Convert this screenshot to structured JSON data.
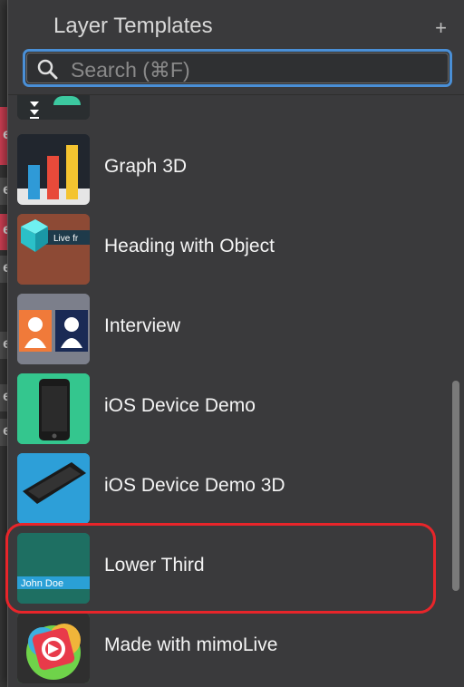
{
  "panel": {
    "title": "Layer Templates",
    "add_button": "+",
    "search_placeholder": "Search (⌘F)"
  },
  "items": [
    {
      "label": ""
    },
    {
      "label": "Graph 3D"
    },
    {
      "label": "Heading with Object",
      "thumb_text": "Live fr"
    },
    {
      "label": "Interview"
    },
    {
      "label": "iOS Device Demo"
    },
    {
      "label": "iOS Device Demo 3D"
    },
    {
      "label": "Lower Third",
      "thumb_text": "John Doe"
    },
    {
      "label": "Made with mimoLive"
    }
  ],
  "left_strip_letter": "e",
  "colors": {
    "accent_blue": "#4a8fd6",
    "highlight_red": "#e8252a",
    "panel_bg": "#3a3a3c"
  }
}
